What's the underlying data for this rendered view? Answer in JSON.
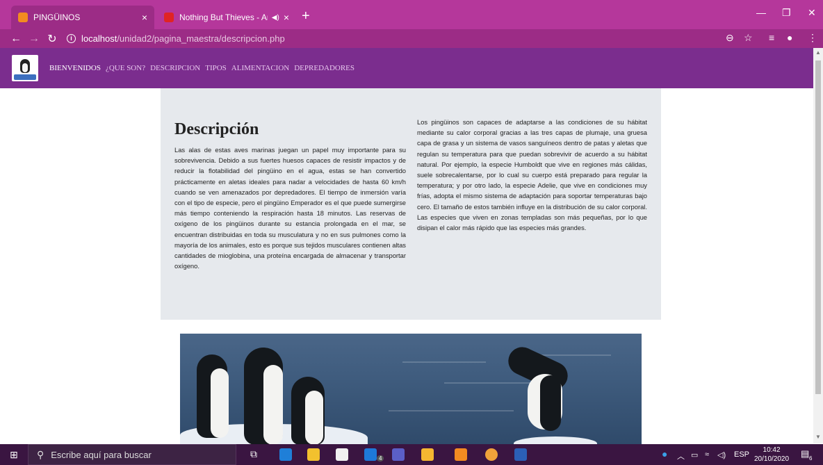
{
  "browser": {
    "tabs": [
      {
        "title": "PINGÜINOS",
        "favicon_color": "#f38b21"
      },
      {
        "title": "Nothing But Thieves - Amsterdam",
        "favicon_color": "#e02424"
      }
    ],
    "close_glyph": "×",
    "new_tab_glyph": "+",
    "address": {
      "host": "localhost",
      "path": "/unidad2/pagina_maestra/descripcion.php"
    }
  },
  "site": {
    "nav": {
      "items": [
        "BIENVENIDOS",
        "¿QUE SON?",
        "DESCRIPCION",
        "TIPOS",
        "ALIMENTACION",
        "DEPREDADORES"
      ]
    },
    "heading": "Descripción",
    "paragraph_left": "Las alas de estas aves marinas juegan un papel muy importante para su sobrevivencia. Debido a sus fuertes huesos capaces de resistir impactos y de reducir la flotabilidad del pingüino en el agua, estas se han convertido prácticamente en aletas ideales para nadar a velocidades de hasta 60 km/h cuando se ven amenazados por depredadores. El tiempo de inmersión varía con el tipo de especie, pero el pingüino Emperador es el que puede sumergirse más tiempo conteniendo la respiración hasta 18 minutos. Las reservas de oxígeno de los pingüinos durante su estancia prolongada en el mar, se encuentran distribuidas en toda su musculatura y no en sus pulmones como la mayoría de los animales, esto es porque sus tejidos musculares contienen altas cantidades de mioglobina, una proteína encargada de almacenar y transportar oxígeno.",
    "paragraph_right": "Los pingüinos son capaces de adaptarse a las condiciones de su hábitat mediante su calor corporal gracias a las tres capas de plumaje, una gruesa capa de grasa y un sistema de vasos sanguíneos dentro de patas y aletas que regulan su temperatura para que puedan sobrevivir de acuerdo a su hábitat natural. Por ejemplo, la especie Humboldt que vive en regiones más cálidas, suele sobrecalentarse, por lo cual su cuerpo está preparado para regular la temperatura; y por otro lado, la especie Adelie, que vive en condiciones muy frías, adopta el mismo sistema de adaptación para soportar temperaturas bajo cero. El tamaño de estos también influye en la distribución de su calor corporal. Las especies que viven en zonas templadas son más pequeñas, por lo que disipan el calor más rápido que las especies más grandes."
  },
  "taskbar": {
    "search_placeholder": "Escribe aquí para buscar",
    "language": "ESP",
    "time": "10:42",
    "date": "20/10/2020",
    "mail_badge": "4",
    "notification_count": "6"
  },
  "colors": {
    "chrome": "#b5379b",
    "navbar": "#7b2d8e",
    "content_bg": "#e6e9ed"
  }
}
